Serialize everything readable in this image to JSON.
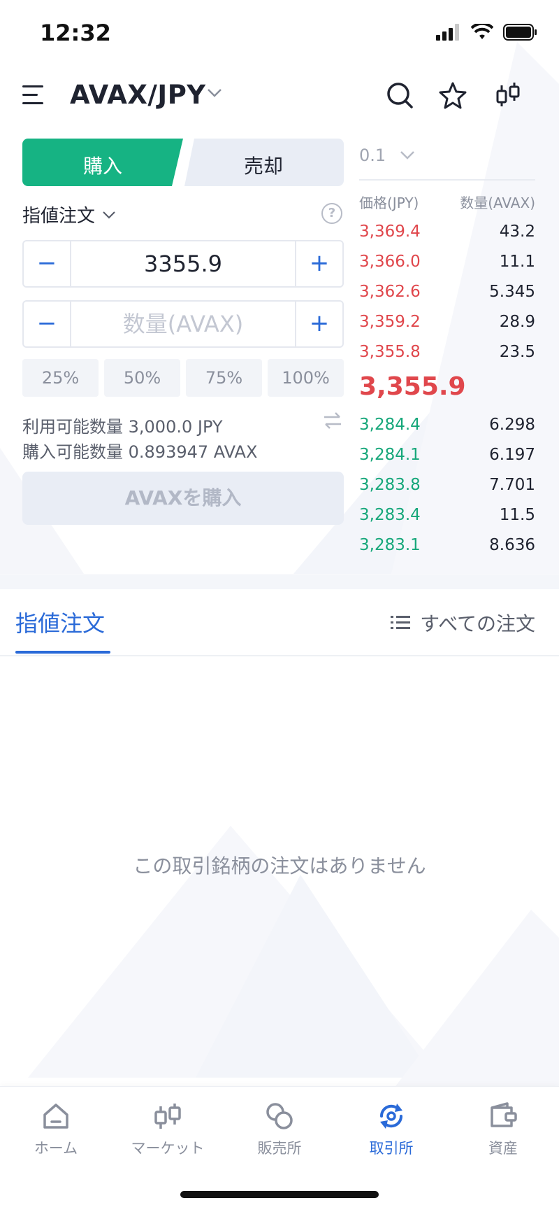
{
  "status_bar": {
    "time": "12:32"
  },
  "header": {
    "pair": "AVAX/JPY"
  },
  "trade": {
    "buy_label": "購入",
    "sell_label": "売却",
    "order_type": "指値注文",
    "help": "?",
    "price_value": "3355.9",
    "qty_placeholder": "数量(AVAX)",
    "percents": [
      "25%",
      "50%",
      "75%",
      "100%"
    ],
    "available": "利用可能数量 3,000.0 JPY",
    "buyable": "購入可能数量 0.893947 AVAX",
    "submit_label": "AVAXを購入"
  },
  "orderbook": {
    "step": "0.1",
    "price_header": "価格(JPY)",
    "qty_header": "数量(AVAX)",
    "asks": [
      {
        "price": "3,369.4",
        "qty": "43.2"
      },
      {
        "price": "3,366.0",
        "qty": "11.1"
      },
      {
        "price": "3,362.6",
        "qty": "5.345"
      },
      {
        "price": "3,359.2",
        "qty": "28.9"
      },
      {
        "price": "3,355.8",
        "qty": "23.5"
      }
    ],
    "last_price": "3,355.9",
    "bids": [
      {
        "price": "3,284.4",
        "qty": "6.298"
      },
      {
        "price": "3,284.1",
        "qty": "6.197"
      },
      {
        "price": "3,283.8",
        "qty": "7.701"
      },
      {
        "price": "3,283.4",
        "qty": "11.5"
      },
      {
        "price": "3,283.1",
        "qty": "8.636"
      }
    ],
    "colors": {
      "ask": "#e0474c",
      "bid": "#16a77a"
    }
  },
  "orders": {
    "tab_label": "指値注文",
    "all_orders_label": "すべての注文",
    "empty_message": "この取引銘柄の注文はありません"
  },
  "nav": {
    "items": [
      {
        "label": "ホーム",
        "icon": "home-icon"
      },
      {
        "label": "マーケット",
        "icon": "market-icon"
      },
      {
        "label": "販売所",
        "icon": "exchange-office-icon"
      },
      {
        "label": "取引所",
        "icon": "trade-icon"
      },
      {
        "label": "資産",
        "icon": "wallet-icon"
      }
    ],
    "active_index": 3
  },
  "colors": {
    "accent": "#2a6ad8",
    "buy": "#16b383",
    "tab_inactive": "#e9edf5"
  }
}
